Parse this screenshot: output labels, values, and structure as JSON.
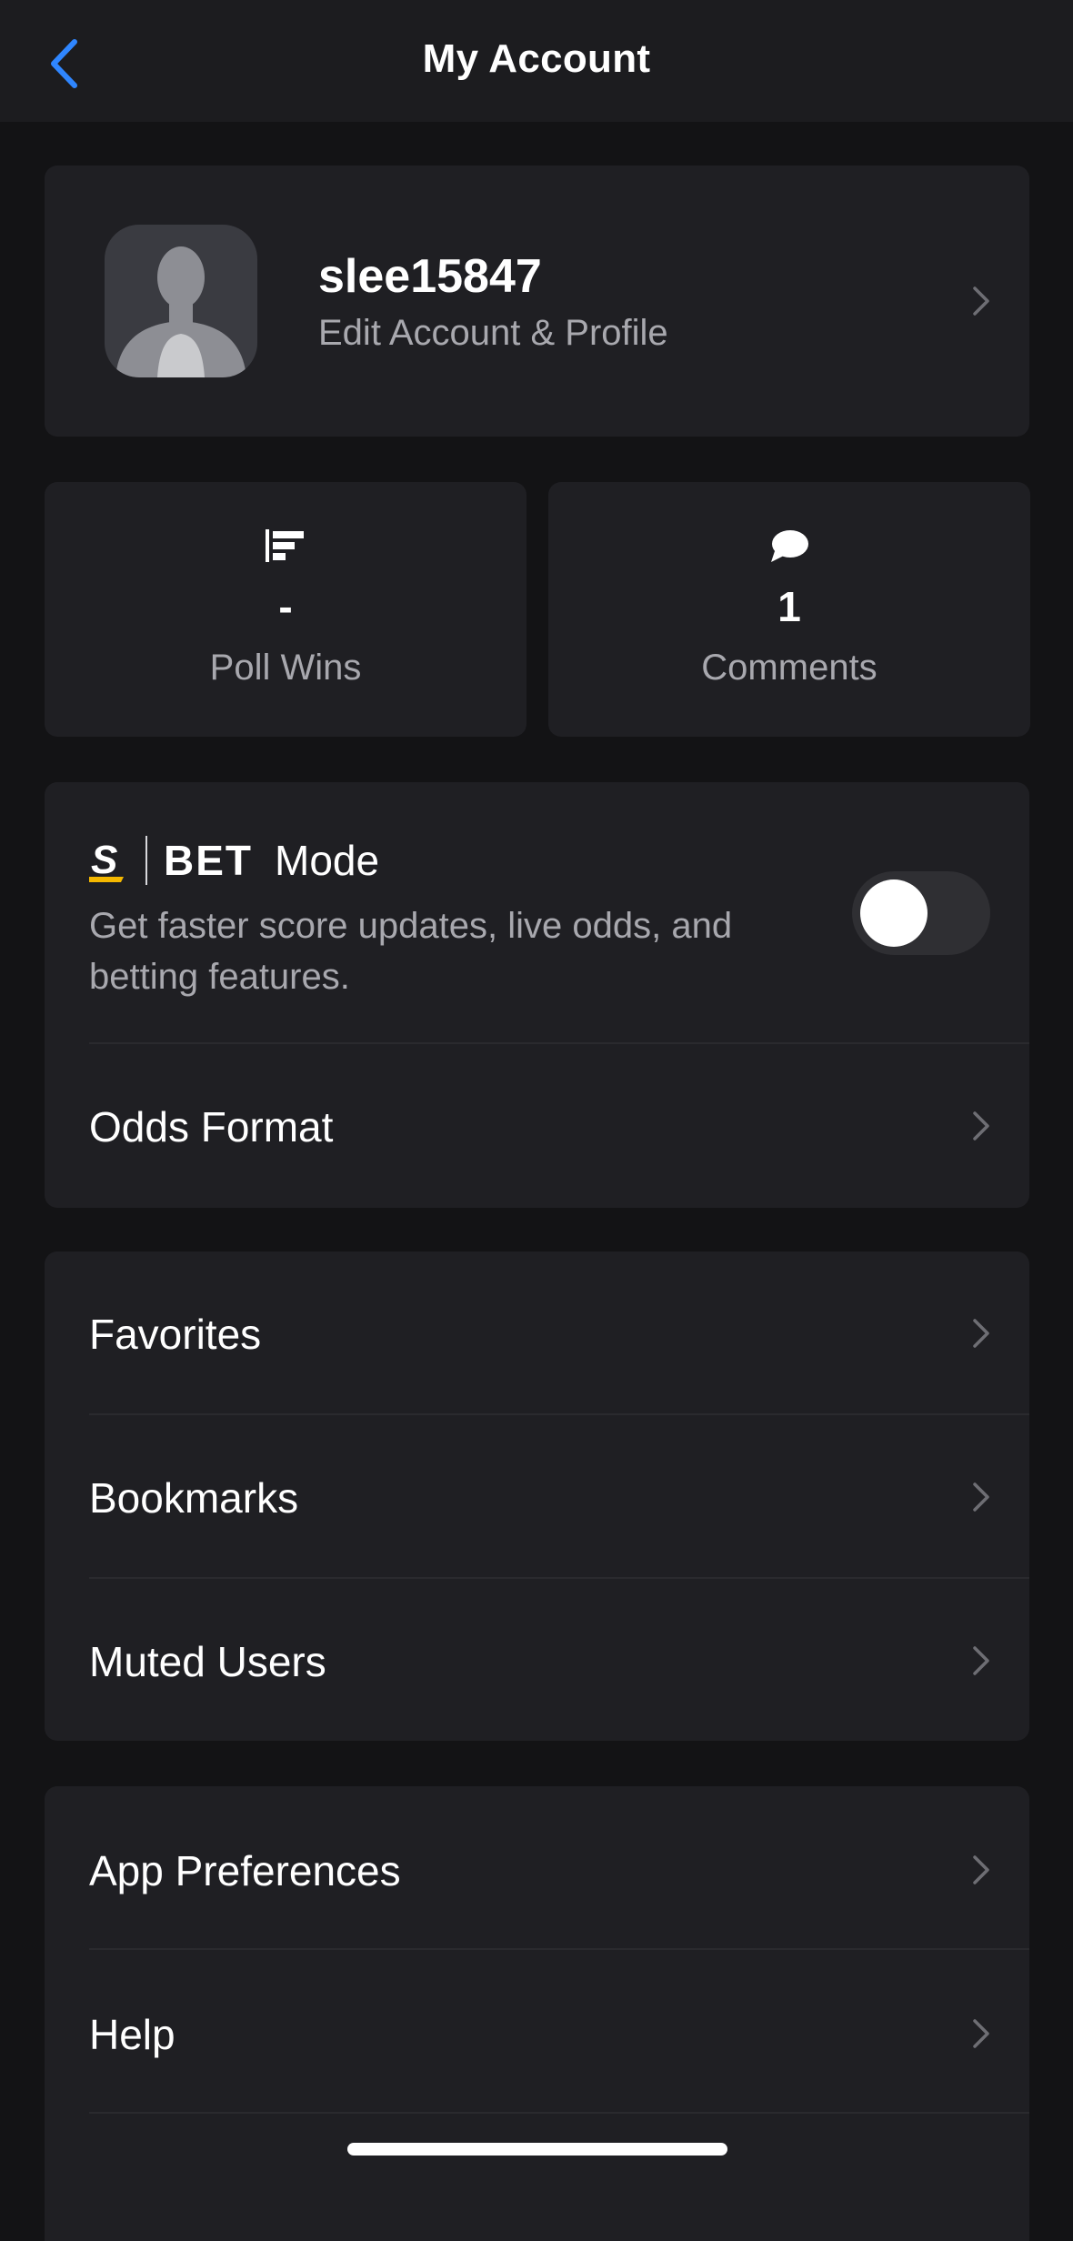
{
  "nav": {
    "title": "My Account",
    "back_icon": "chevron-left-icon",
    "accent_color": "#2f86ff"
  },
  "profile": {
    "username": "slee15847",
    "subtitle": "Edit Account & Profile",
    "avatar_icon": "person-silhouette-icon"
  },
  "stats": [
    {
      "icon": "poll-bars-icon",
      "value": "-",
      "label": "Poll Wins"
    },
    {
      "icon": "comment-bubble-icon",
      "value": "1",
      "label": "Comments"
    }
  ],
  "bet": {
    "brand_mark": "S",
    "brand_word": "BET",
    "mode_label": "Mode",
    "description": "Get faster score updates, live odds, and betting features.",
    "toggle_on": false,
    "brand_color": "#f5b800"
  },
  "odds_format": {
    "label": "Odds Format"
  },
  "library": {
    "items": [
      {
        "label": "Favorites"
      },
      {
        "label": "Bookmarks"
      },
      {
        "label": "Muted Users"
      }
    ]
  },
  "settings": {
    "items": [
      {
        "label": "App Preferences"
      },
      {
        "label": "Help"
      }
    ]
  }
}
